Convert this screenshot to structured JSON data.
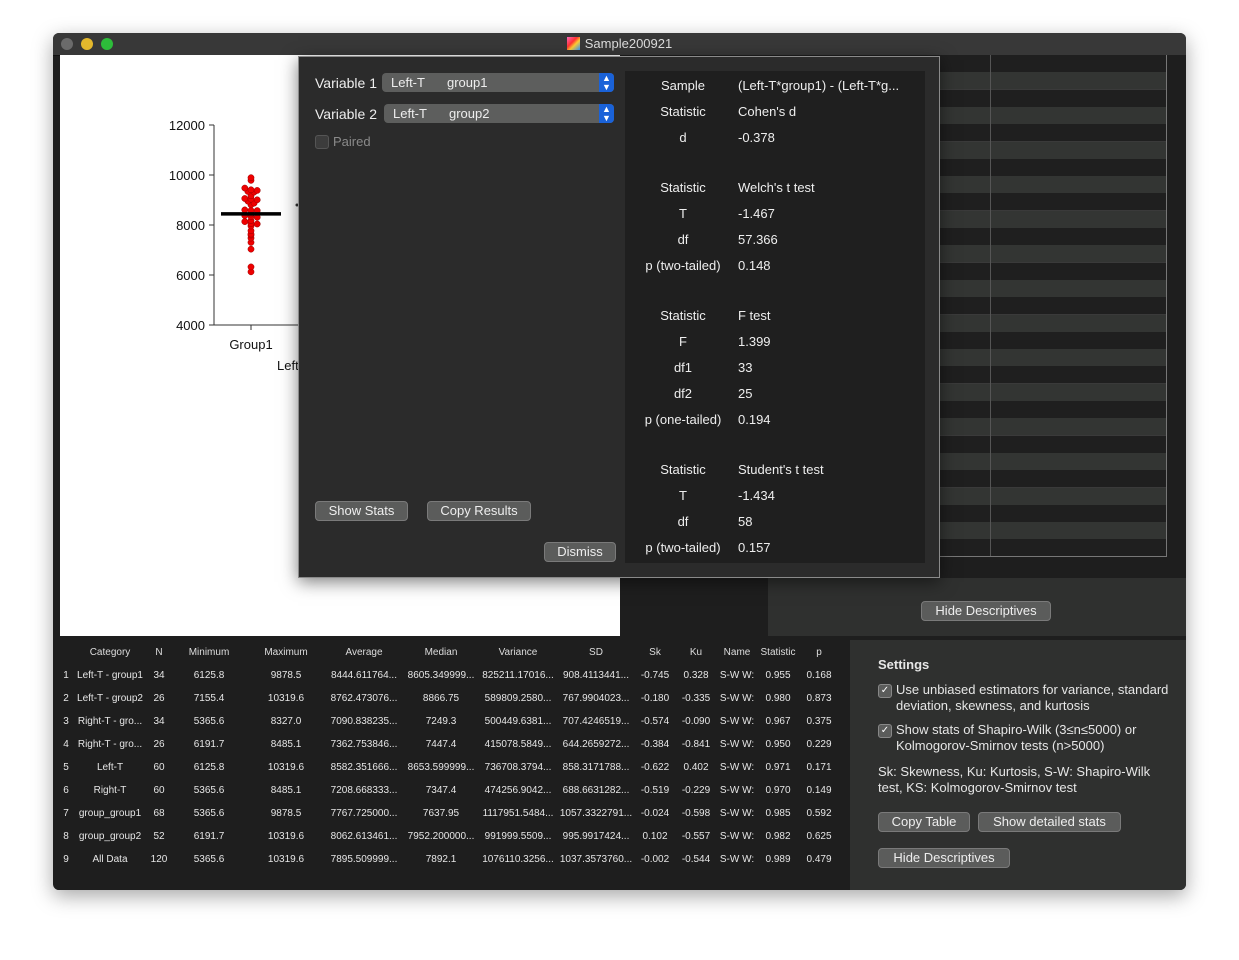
{
  "window": {
    "title": "Sample200921",
    "traffic_lights": {
      "close": "#6b6b6b",
      "minimize": "#e4b82c",
      "zoom": "#2dbd3a"
    }
  },
  "chart_data": {
    "type": "scatter",
    "yticks": [
      4000,
      6000,
      8000,
      10000,
      12000
    ],
    "ylim": [
      4000,
      12000
    ],
    "categories": [
      "Group1"
    ],
    "group_label": "Left-T",
    "point_color": "#ee0000",
    "series": [
      {
        "category": "Group1",
        "mean": 8444.6,
        "values": [
          9893,
          9785,
          9316,
          9383,
          9477,
          9409,
          9342,
          9168,
          8953,
          9007,
          9060,
          9034,
          8873,
          8806,
          8577,
          8604,
          8580,
          8135,
          8336,
          8443,
          8309,
          8376,
          8175,
          7960,
          8040,
          8054,
          7598,
          7638,
          7772,
          7477,
          7302,
          7034,
          6323,
          6126
        ]
      }
    ]
  },
  "dialog": {
    "variable1_label": "Variable 1",
    "variable1_value": [
      "Left-T",
      "group1"
    ],
    "variable2_label": "Variable 2",
    "variable2_value": [
      "Left-T",
      "group2"
    ],
    "paired_label": "Paired",
    "paired_checked": false,
    "show_stats": "Show Stats",
    "copy_results": "Copy Results",
    "dismiss": "Dismiss",
    "results": [
      [
        [
          "Sample",
          "(Left-T*group1) - (Left-T*g..."
        ],
        [
          "Statistic",
          "Cohen's d"
        ],
        [
          "d",
          "-0.378"
        ]
      ],
      [
        [
          "Statistic",
          "Welch's t test"
        ],
        [
          "T",
          "-1.467"
        ],
        [
          "df",
          "57.366"
        ],
        [
          "p (two-tailed)",
          "0.148"
        ]
      ],
      [
        [
          "Statistic",
          "F test"
        ],
        [
          "F",
          "1.399"
        ],
        [
          "df1",
          "33"
        ],
        [
          "df2",
          "25"
        ],
        [
          "p (one-tailed)",
          "0.194"
        ]
      ],
      [
        [
          "Statistic",
          "Student's t test"
        ],
        [
          "T",
          "-1.434"
        ],
        [
          "df",
          "58"
        ],
        [
          "p (two-tailed)",
          "0.157"
        ]
      ]
    ]
  },
  "back_hide_descriptives": "Hide Descriptives",
  "table": {
    "columns": [
      "",
      "Category",
      "N",
      "Minimum",
      "Maximum",
      "Average",
      "Median",
      "Variance",
      "SD",
      "Sk",
      "Ku",
      "Name",
      "Statistic",
      "p"
    ],
    "rows": [
      [
        "1",
        "Left-T - group1",
        "34",
        "6125.8",
        "9878.5",
        "8444.611764...",
        "8605.349999...",
        "825211.17016...",
        "908.4113441...",
        "-0.745",
        "0.328",
        "S-W W:",
        "0.955",
        "0.168"
      ],
      [
        "2",
        "Left-T - group2",
        "26",
        "7155.4",
        "10319.6",
        "8762.473076...",
        "8866.75",
        "589809.2580...",
        "767.9904023...",
        "-0.180",
        "-0.335",
        "S-W W:",
        "0.980",
        "0.873"
      ],
      [
        "3",
        "Right-T - gro...",
        "34",
        "5365.6",
        "8327.0",
        "7090.838235...",
        "7249.3",
        "500449.6381...",
        "707.4246519...",
        "-0.574",
        "-0.090",
        "S-W W:",
        "0.967",
        "0.375"
      ],
      [
        "4",
        "Right-T - gro...",
        "26",
        "6191.7",
        "8485.1",
        "7362.753846...",
        "7447.4",
        "415078.5849...",
        "644.2659272...",
        "-0.384",
        "-0.841",
        "S-W W:",
        "0.950",
        "0.229"
      ],
      [
        "5",
        "Left-T",
        "60",
        "6125.8",
        "10319.6",
        "8582.351666...",
        "8653.599999...",
        "736708.3794...",
        "858.3171788...",
        "-0.622",
        "0.402",
        "S-W W:",
        "0.971",
        "0.171"
      ],
      [
        "6",
        "Right-T",
        "60",
        "5365.6",
        "8485.1",
        "7208.668333...",
        "7347.4",
        "474256.9042...",
        "688.6631282...",
        "-0.519",
        "-0.229",
        "S-W W:",
        "0.970",
        "0.149"
      ],
      [
        "7",
        "group_group1",
        "68",
        "5365.6",
        "9878.5",
        "7767.725000...",
        "7637.95",
        "1117951.5484...",
        "1057.3322791...",
        "-0.024",
        "-0.598",
        "S-W W:",
        "0.985",
        "0.592"
      ],
      [
        "8",
        "group_group2",
        "52",
        "6191.7",
        "10319.6",
        "8062.613461...",
        "7952.200000...",
        "991999.5509...",
        "995.9917424...",
        "0.102",
        "-0.557",
        "S-W W:",
        "0.982",
        "0.625"
      ],
      [
        "9",
        "All Data",
        "120",
        "5365.6",
        "10319.6",
        "7895.509999...",
        "7892.1",
        "1076110.3256...",
        "1037.3573760...",
        "-0.002",
        "-0.544",
        "S-W W:",
        "0.989",
        "0.479"
      ]
    ]
  },
  "settings": {
    "title": "Settings",
    "option1": {
      "label": "Use unbiased estimators for variance, standard deviation, skewness, and kurtosis",
      "checked": true
    },
    "option2": {
      "label": "Show stats of Shapiro-Wilk (3≤n≤5000) or Kolmogorov-Smirnov tests (n>5000)",
      "checked": true
    },
    "legend": "Sk: Skewness, Ku: Kurtosis, S-W: Shapiro-Wilk test, KS: Kolmogorov-Smirnov test",
    "copy_table": "Copy Table",
    "show_detailed": "Show detailed stats",
    "hide_descriptives": "Hide Descriptives"
  }
}
